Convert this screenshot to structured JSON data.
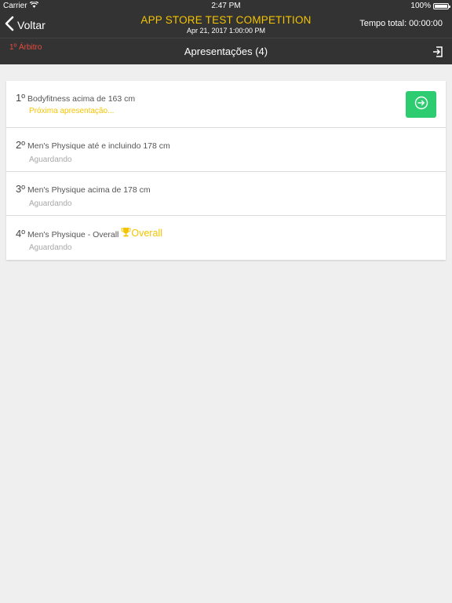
{
  "status_bar": {
    "carrier": "Carrier",
    "time": "2:47 PM",
    "battery": "100%",
    "battery_level": 1.0
  },
  "nav": {
    "back_label": "Voltar",
    "title": "APP STORE TEST COMPETITION",
    "subtitle": "Apr 21, 2017 1:00:00 PM",
    "timer": "Tempo total: 00:00:00"
  },
  "sub_header": {
    "judge": "1º Árbitro",
    "title": "Apresentações (4)"
  },
  "presentations": [
    {
      "number": "1º",
      "name": "Bodyfitness acima de 163 cm",
      "status": "Próxima apresentação...",
      "overall": ""
    },
    {
      "number": "2º",
      "name": "Men's Physique até e incluindo 178 cm",
      "status": "Aguardando",
      "overall": ""
    },
    {
      "number": "3º",
      "name": "Men's Physique acima de 178 cm",
      "status": "Aguardando",
      "overall": ""
    },
    {
      "number": "4º",
      "name": "Men's Physique - Overall",
      "status": "Aguardando",
      "overall": "Overall"
    }
  ],
  "colors": {
    "bar_background": "#333333",
    "accent_yellow": "#f5c400",
    "judge_red": "#e74c3c",
    "start_green": "#2ecc71",
    "page_background": "#efefef"
  },
  "icons": [
    "wifi-icon",
    "battery-icon",
    "chevron-left-icon",
    "exit-icon",
    "enter-icon",
    "trophy-icon"
  ]
}
